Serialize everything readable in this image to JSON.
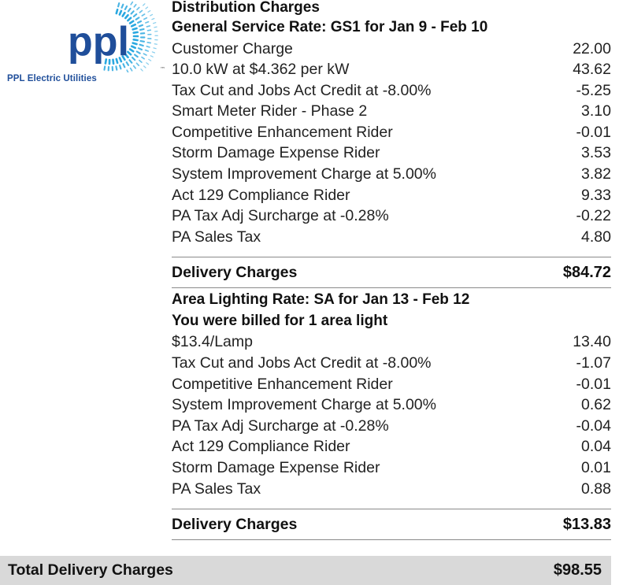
{
  "logo": {
    "wordmark": "ppl",
    "tagline": "PPL Electric Utilities",
    "trademark": "™",
    "brand_color": "#1f4e9a",
    "rays_color": "#2aa8e0"
  },
  "distribution": {
    "title": "Distribution Charges",
    "general_service": {
      "heading": "General Service Rate: GS1 for Jan  9 - Feb 10",
      "lines": [
        {
          "label": "Customer Charge",
          "amount": "22.00"
        },
        {
          "label": "10.0 kW at $4.362 per kW",
          "amount": "43.62"
        },
        {
          "label": "Tax Cut and Jobs Act Credit at -8.00%",
          "amount": "-5.25"
        },
        {
          "label": "Smart Meter Rider - Phase 2",
          "amount": "3.10"
        },
        {
          "label": "Competitive Enhancement Rider",
          "amount": "-0.01"
        },
        {
          "label": "Storm Damage Expense Rider",
          "amount": "3.53"
        },
        {
          "label": "System Improvement Charge at 5.00%",
          "amount": "3.82"
        },
        {
          "label": "Act 129 Compliance Rider",
          "amount": "9.33"
        },
        {
          "label": "PA Tax Adj Surcharge at -0.28%",
          "amount": "-0.22"
        },
        {
          "label": "PA Sales Tax",
          "amount": "4.80"
        }
      ],
      "subtotal_label": "Delivery Charges",
      "subtotal_amount": "$84.72"
    },
    "area_lighting": {
      "heading": "Area Lighting Rate: SA for Jan 13 - Feb 12",
      "note": "You were billed for 1 area light",
      "lines": [
        {
          "label": "$13.4/Lamp",
          "amount": "13.40"
        },
        {
          "label": "Tax Cut and Jobs Act Credit at -8.00%",
          "amount": "-1.07"
        },
        {
          "label": "Competitive Enhancement Rider",
          "amount": "-0.01"
        },
        {
          "label": "System Improvement Charge at 5.00%",
          "amount": "0.62"
        },
        {
          "label": "PA Tax Adj Surcharge at -0.28%",
          "amount": "-0.04"
        },
        {
          "label": "Act 129 Compliance Rider",
          "amount": "0.04"
        },
        {
          "label": "Storm Damage Expense Rider",
          "amount": "0.01"
        },
        {
          "label": "PA Sales Tax",
          "amount": "0.88"
        }
      ],
      "subtotal_label": "Delivery Charges",
      "subtotal_amount": "$13.83"
    }
  },
  "total": {
    "label": "Total Delivery Charges",
    "amount": "$98.55"
  }
}
